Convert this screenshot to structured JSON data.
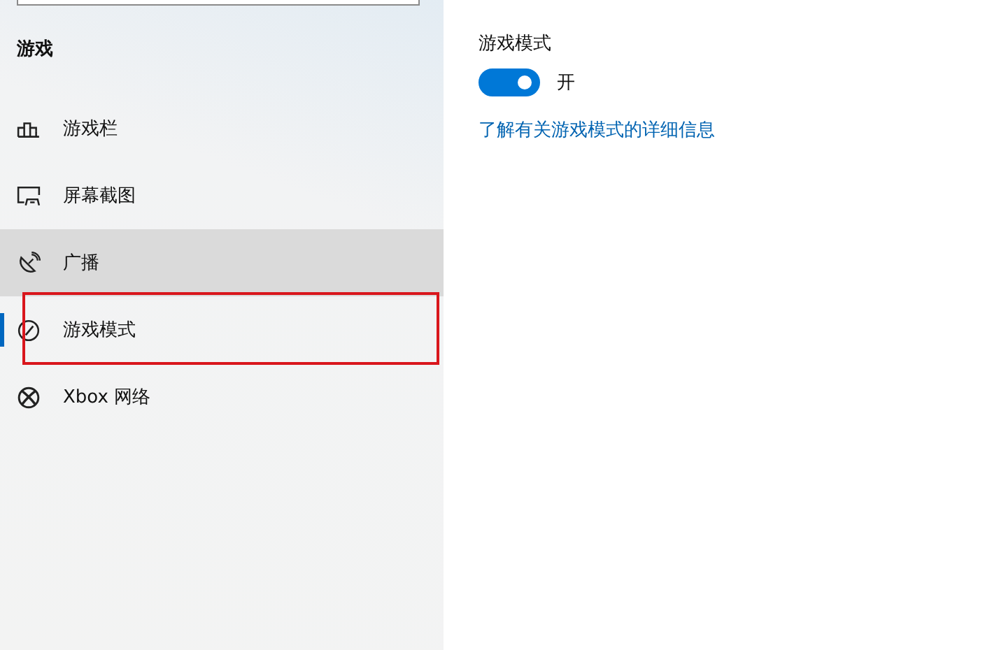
{
  "sidebar": {
    "heading": "游戏",
    "items": [
      {
        "label": "游戏栏",
        "selected": false,
        "hovered": false,
        "highlighted": false
      },
      {
        "label": "屏幕截图",
        "selected": false,
        "hovered": false,
        "highlighted": false
      },
      {
        "label": "广播",
        "selected": false,
        "hovered": true,
        "highlighted": false
      },
      {
        "label": "游戏模式",
        "selected": true,
        "hovered": false,
        "highlighted": true
      },
      {
        "label": "Xbox 网络",
        "selected": false,
        "hovered": false,
        "highlighted": false
      }
    ]
  },
  "content": {
    "section_title": "游戏模式",
    "toggle": {
      "on": true,
      "state_label": "开"
    },
    "link": "了解有关游戏模式的详细信息"
  }
}
